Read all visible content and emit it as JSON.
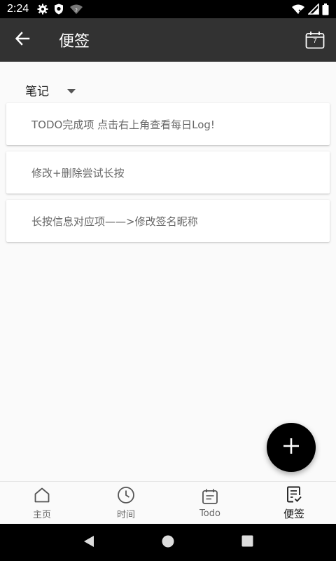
{
  "status_bar": {
    "time": "2:24",
    "left_icons": [
      "gear-icon",
      "shield-icon",
      "wifi-question-icon"
    ],
    "right_icons": [
      "wifi-off-icon",
      "signal-icon",
      "battery-icon"
    ]
  },
  "app_bar": {
    "title": "便签",
    "calendar_day": "7"
  },
  "category": {
    "selected": "笔记"
  },
  "notes": [
    "TODO完成项 点击右上角查看每日Log!",
    "修改+删除尝试长按",
    "长按信息对应项——>修改签名昵称"
  ],
  "bottom_nav": {
    "items": [
      {
        "label": "主页",
        "icon": "home-icon"
      },
      {
        "label": "时间",
        "icon": "clock-icon"
      },
      {
        "label": "Todo",
        "icon": "todo-icon"
      },
      {
        "label": "便签",
        "icon": "note-icon",
        "active": true
      }
    ]
  },
  "colors": {
    "app_bar": "#323232",
    "status_bar": "#000000",
    "fab": "#000000",
    "background": "#fafafa"
  }
}
